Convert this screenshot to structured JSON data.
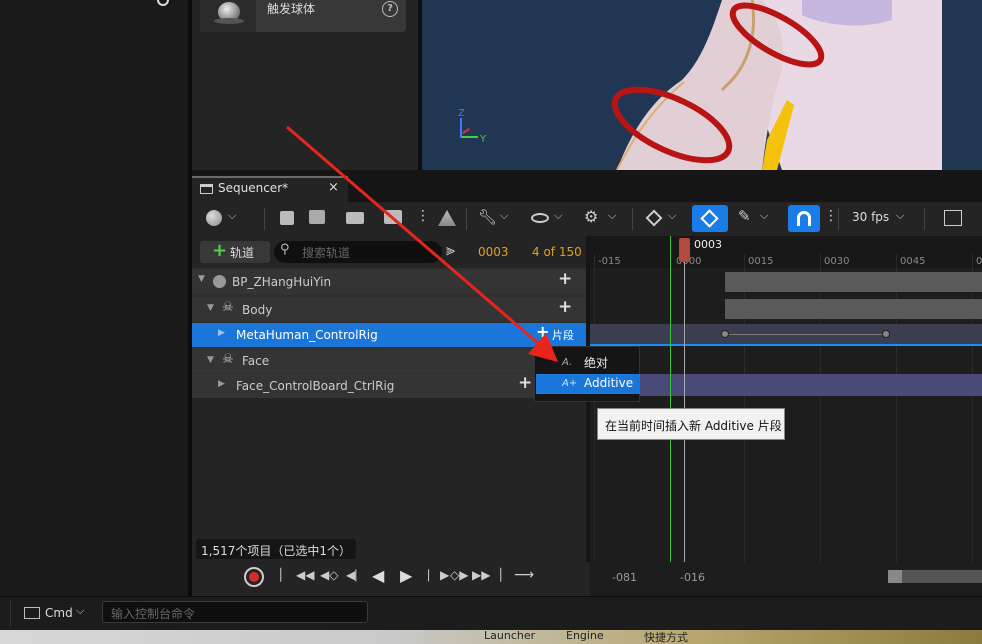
{
  "top_panel": {
    "asset_item_label": "触发球体"
  },
  "viewport": {
    "axis_z": "Z",
    "axis_y": "Y"
  },
  "sequencer": {
    "tab_title": "Sequencer*",
    "add_track_label": "轨道",
    "search_placeholder": "搜索轨道",
    "current_frame": "0003",
    "frame_count": "4 of 150",
    "fps_label": "30 fps",
    "status_text": "1,517个项目（已选中1个）",
    "tracks": [
      {
        "label": "BP_ZHangHuiYin"
      },
      {
        "label": "Body"
      },
      {
        "label": "MetaHuman_ControlRig",
        "action": "片段"
      },
      {
        "label": "Face"
      },
      {
        "label": "Face_ControlBoard_CtrlRig"
      }
    ],
    "timeline": {
      "playhead_label": "0003",
      "ticks": [
        "-015",
        "0000",
        "0015",
        "0030",
        "0045",
        "0"
      ],
      "range_start": "-081",
      "range_end": "-016"
    }
  },
  "context_menu": {
    "items": [
      {
        "label": "绝对"
      },
      {
        "label": "Additive"
      }
    ],
    "tooltip": "在当前时间插入新 Additive 片段"
  },
  "console": {
    "cmd_label": "Cmd",
    "input_placeholder": "输入控制台命令"
  },
  "taskbar": {
    "items": [
      "Launcher",
      "Engine",
      "快捷方式"
    ]
  }
}
